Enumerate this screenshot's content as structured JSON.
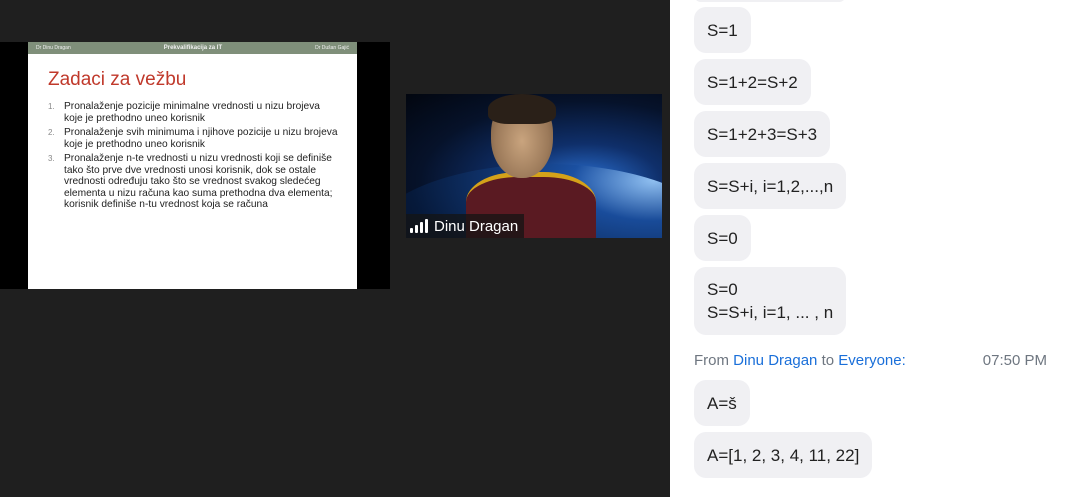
{
  "slide": {
    "header_left": "Dr Dinu Dragan",
    "header_center": "Prekvalifikacija za IT",
    "header_right": "Dr Dušan Gajić",
    "title": "Zadaci za vežbu",
    "items": [
      {
        "num": "1.",
        "text": "Pronalaženje pozicije minimalne vrednosti u nizu brojeva koje je prethodno uneo korisnik"
      },
      {
        "num": "2.",
        "text": "Pronalaženje svih minimuma i njihove pozicije u nizu brojeva koje je prethodno uneo korisnik"
      },
      {
        "num": "3.",
        "text": "Pronalaženje n-te vrednosti u nizu vrednosti koji se definiše tako što prve dve vrednosti unosi korisnik, dok se ostale vrednosti određuju tako što se vrednost svakog sledećeg elementa u nizu računa kao suma prethodna dva elementa; korisnik definiše n-tu vrednost koja se računa"
      }
    ]
  },
  "video": {
    "participant_name": "Dinu Dragan"
  },
  "chat": {
    "messages_before": [
      "S=1",
      "S=1+2=S+2",
      "S=1+2+3=S+3",
      "S=S+i, i=1,2,...,n",
      "S=0"
    ],
    "multiline_message": [
      "S=0",
      "S=S+i, i=1, ... , n"
    ],
    "sender_prefix": "From",
    "sender": "Dinu Dragan",
    "to_word": "to",
    "recipient": "Everyone:",
    "time": "07:50 PM",
    "messages_after": [
      "A=š",
      "A=[1, 2, 3, 4, 11, 22]"
    ]
  },
  "colors": {
    "slide_title": "#c0392b",
    "link": "#1a6fd9",
    "bubble": "#f0f0f3",
    "stage_bg": "#1f1f1f"
  }
}
